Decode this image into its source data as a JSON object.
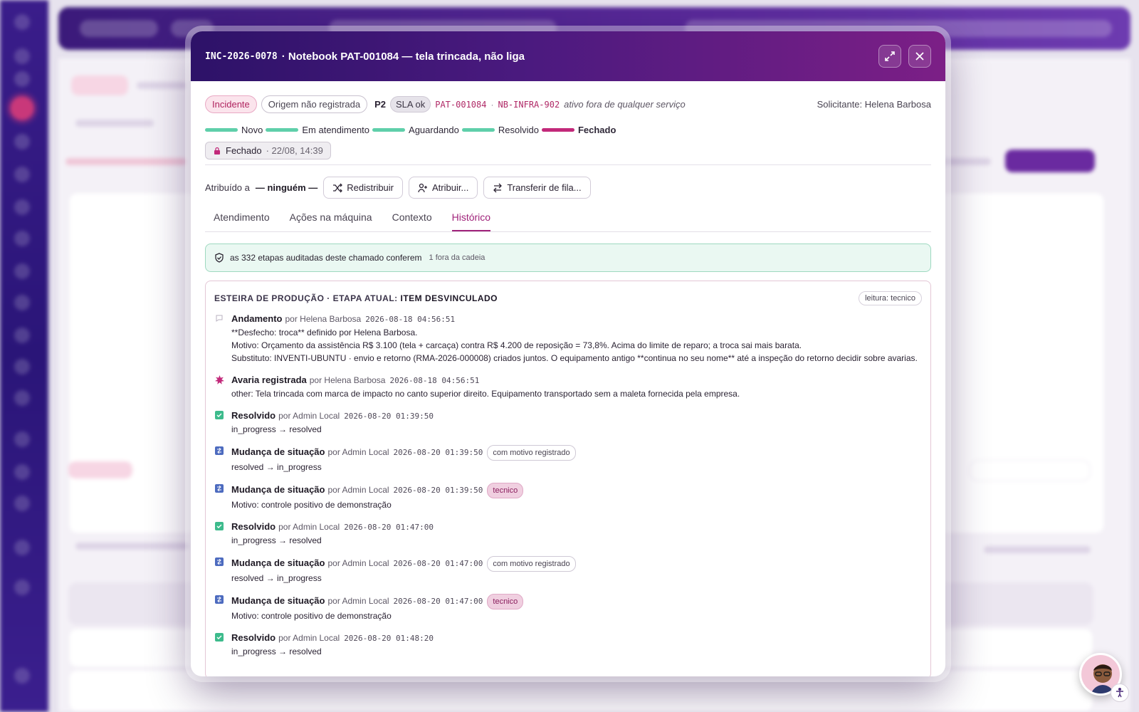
{
  "dialog": {
    "code": "INC-2026-0078",
    "title": "· Notebook PAT-001084 — tela trincada, não liga"
  },
  "meta": {
    "type": "Incidente",
    "origin": "Origem não registrada",
    "priority": "P2",
    "sla": "SLA ok",
    "asset_code": "PAT-001084",
    "separator": "·",
    "host": "NB-INFRA-902",
    "asset_note": "ativo fora de qualquer serviço",
    "requester": "Solicitante: Helena Barbosa"
  },
  "stepper": [
    "Novo",
    "Em atendimento",
    "Aguardando",
    "Resolvido",
    "Fechado"
  ],
  "closed": {
    "label": "Fechado",
    "when": "· 22/08, 14:39"
  },
  "assign": {
    "prefix": "Atribuído a",
    "who": "— ninguém —",
    "redistribute": "Redistribuir",
    "assign": "Atribuir...",
    "transfer": "Transferir de fila..."
  },
  "tabs": [
    "Atendimento",
    "Ações na máquina",
    "Contexto",
    "Histórico"
  ],
  "audit": {
    "text": "as 332 etapas auditadas deste chamado conferem",
    "extra": "1 fora da cadeia"
  },
  "history": {
    "title_prefix": "ESTEIRA DE PRODUÇÃO · ETAPA ATUAL:",
    "title_stage": "ITEM DESVINCULADO",
    "reader": "leitura: tecnico",
    "events": [
      {
        "title": "Andamento",
        "by": "por Helena Barbosa",
        "ts": "2026-08-18 04:56:51",
        "lines": [
          "**Desfecho: troca** definido por Helena Barbosa.",
          "Motivo: Orçamento da assistência R$ 3.100 (tela + carcaça) contra R$ 4.200 de reposição = 73,8%. Acima do limite de reparo; a troca sai mais barata.",
          "Substituto: INVENTI-UBUNTU · envio e retorno (RMA-2026-000008) criados juntos. O equipamento antigo **continua no seu nome** até a inspeção do retorno decidir sobre avarias."
        ]
      },
      {
        "title": "Avaria registrada",
        "by": "por Helena Barbosa",
        "ts": "2026-08-18 04:56:51",
        "lines": [
          "other: Tela trincada com marca de impacto no canto superior direito. Equipamento transportado sem a maleta fornecida pela empresa."
        ]
      },
      {
        "title": "Resolvido",
        "by": "por Admin Local",
        "ts": "2026-08-20 01:39:50",
        "lines": [
          "in_progress → resolved"
        ]
      },
      {
        "title": "Mudança de situação",
        "by": "por Admin Local",
        "ts": "2026-08-20 01:39:50",
        "tag": "com motivo registrado",
        "lines": [
          "resolved → in_progress"
        ]
      },
      {
        "title": "Mudança de situação",
        "by": "por Admin Local",
        "ts": "2026-08-20 01:39:50",
        "tag": "tecnico",
        "lines": [
          "Motivo: controle positivo de demonstração"
        ]
      },
      {
        "title": "Resolvido",
        "by": "por Admin Local",
        "ts": "2026-08-20 01:47:00",
        "lines": [
          "in_progress → resolved"
        ]
      },
      {
        "title": "Mudança de situação",
        "by": "por Admin Local",
        "ts": "2026-08-20 01:47:00",
        "tag": "com motivo registrado",
        "lines": [
          "resolved → in_progress"
        ]
      },
      {
        "title": "Mudança de situação",
        "by": "por Admin Local",
        "ts": "2026-08-20 01:47:00",
        "tag": "tecnico",
        "lines": [
          "Motivo: controle positivo de demonstração"
        ]
      },
      {
        "title": "Resolvido",
        "by": "por Admin Local",
        "ts": "2026-08-20 01:48:20",
        "lines": [
          "in_progress → resolved"
        ]
      }
    ]
  },
  "colors": {
    "accent": "#a0237a",
    "header_start": "#2d1268",
    "header_end": "#7c1f86",
    "step_done": "#5fcfaa",
    "step_current": "#c2297a",
    "audit_bg": "#eaf8f2"
  }
}
